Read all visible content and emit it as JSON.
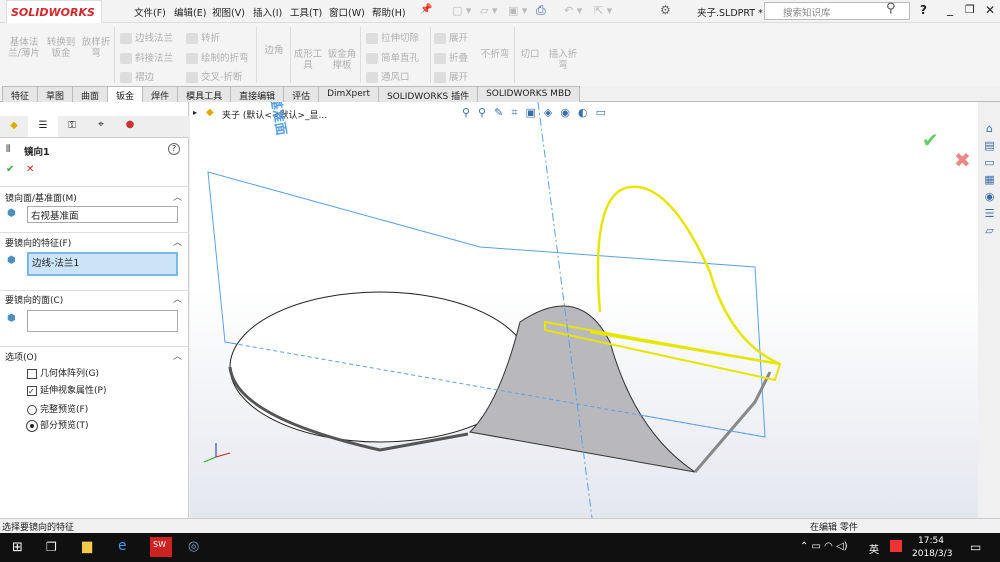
{
  "app": {
    "logo": "SOLIDWORKS",
    "file": "夹子.SLDPRT *",
    "search_placeholder": "搜索知识库"
  },
  "menu": [
    "文件(F)",
    "编辑(E)",
    "视图(V)",
    "插入(I)",
    "工具(T)",
    "窗口(W)",
    "帮助(H)"
  ],
  "ribbon": {
    "big1": [
      "基体法兰/薄片",
      "转换到钣金",
      "放样折弯"
    ],
    "col1": [
      "边线法兰",
      "斜接法兰",
      "褶边"
    ],
    "col2": [
      "转折",
      "绘制的折弯",
      "交叉-折断"
    ],
    "corner": "边角",
    "big2": [
      "成形工具",
      "钣金角撑板"
    ],
    "col3": [
      "拉伸切除",
      "简单直孔",
      "通风口"
    ],
    "col4": [
      "展开",
      "折叠",
      "展开"
    ],
    "big3": [
      "不折弯",
      "切口",
      "插入折弯"
    ]
  },
  "tabs": [
    "特征",
    "草图",
    "曲面",
    "钣金",
    "焊件",
    "模具工具",
    "直接编辑",
    "评估",
    "DimXpert",
    "SOLIDWORKS 插件",
    "SOLIDWORKS MBD"
  ],
  "active_tab": "钣金",
  "panel": {
    "title": "镜向1",
    "help": "?",
    "s1": {
      "label": "镜向面/基准面(M)",
      "value": "右视基准面"
    },
    "s2": {
      "label": "要镜向的特征(F)",
      "value": "边线-法兰1"
    },
    "s3": {
      "label": "要镜向的面(C)",
      "value": ""
    },
    "s4": {
      "label": "选项(O)",
      "opt1": "几何体阵列(G)",
      "opt2": "延伸视象属性(P)",
      "opt3": "完整预览(F)",
      "opt4": "部分预览(T)"
    }
  },
  "options_state": {
    "geometry_pattern": false,
    "propagate_visual": true,
    "preview": "partial"
  },
  "tree": {
    "label": "夹子 (默认<<默认>_显..."
  },
  "viewport": {
    "plane_label": "右视基准面"
  },
  "status": {
    "left": "选择要镜向的特征",
    "right": "在编辑 零件"
  },
  "taskbar": {
    "time": "17:54",
    "date": "2018/3/3",
    "ime": "英"
  },
  "colors": {
    "accent": "#d3262a",
    "selection": "#cce4f7",
    "plane": "#5aa0e6",
    "preview": "#e6e600"
  }
}
